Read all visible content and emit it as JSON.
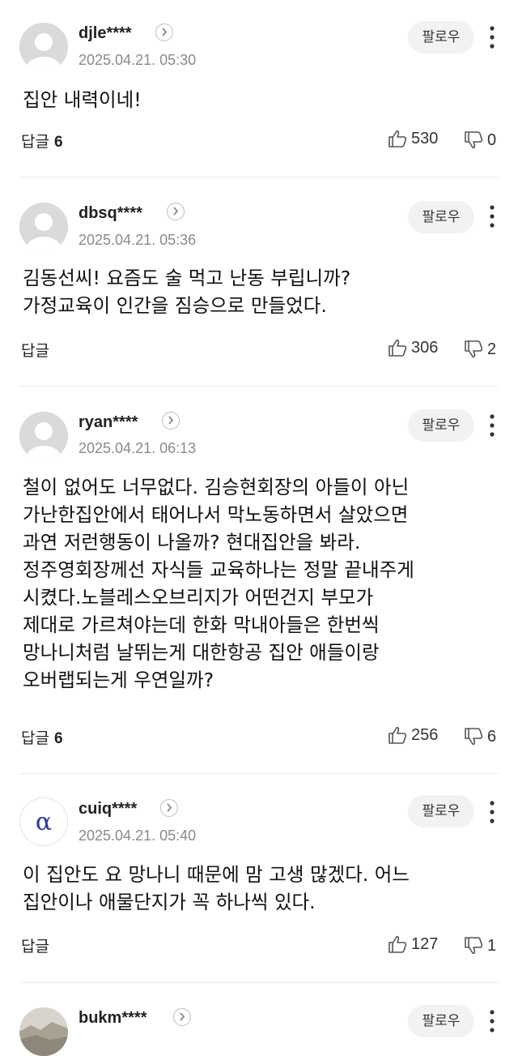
{
  "comments": [
    {
      "nickname": "djle****",
      "date": "2025.04.21. 05:30",
      "follow_label": "팔로우",
      "text": "집안 내력이네!",
      "reply_label": "답글",
      "reply_count": "6",
      "likes": "530",
      "dislikes": "0",
      "avatar": "default-avatar"
    },
    {
      "nickname": "dbsq****",
      "date": "2025.04.21. 05:36",
      "follow_label": "팔로우",
      "text": "김동선씨! 요즘도 술 먹고 난동 부립니까?\n가정교육이 인간을 짐승으로 만들었다.",
      "reply_label": "답글",
      "reply_count": "",
      "likes": "306",
      "dislikes": "2",
      "avatar": "default-avatar"
    },
    {
      "nickname": "ryan****",
      "date": "2025.04.21. 06:13",
      "follow_label": "팔로우",
      "text": "철이 없어도 너무없다. 김승현회장의 아들이 아닌\n가난한집안에서 태어나서 막노동하면서 살았으면\n과연 저런행동이 나올까? 현대집안을 봐라.\n정주영회장께선 자식들 교육하나는 정말 끝내주게\n시켰다.노블레스오브리지가 어떤건지 부모가\n제대로 가르쳐야는데 한화 막내아들은 한번씩\n망나니처럼 날뛰는게 대한항공 집안 애들이랑\n오버랩되는게 우연일까?",
      "reply_label": "답글",
      "reply_count": "6",
      "likes": "256",
      "dislikes": "6",
      "avatar": "default-avatar"
    },
    {
      "nickname": "cuiq****",
      "date": "2025.04.21. 05:40",
      "follow_label": "팔로우",
      "text": "이 집안도 요 망나니 때문에 맘 고생 많겠다. 어느\n집안이나 애물단지가 꼭 하나씩 있다.",
      "reply_label": "답글",
      "reply_count": "",
      "likes": "127",
      "dislikes": "1",
      "avatar": "alpha-avatar"
    },
    {
      "nickname": "bukm****",
      "follow_label": "팔로우",
      "avatar": "photo-avatar"
    }
  ]
}
